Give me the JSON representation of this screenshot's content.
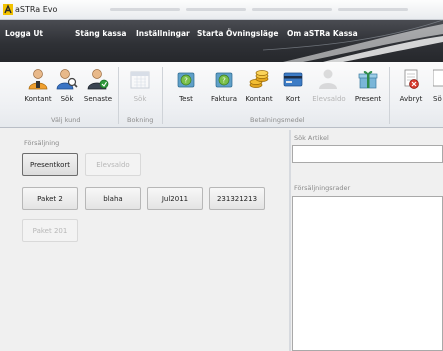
{
  "window": {
    "title": "aSTRa Evo"
  },
  "menu": {
    "items": [
      {
        "label": "Logga Ut"
      },
      {
        "label": "Stäng kassa"
      },
      {
        "label": "Inställningar"
      },
      {
        "label": "Starta Övningsläge"
      },
      {
        "label": "Om aSTRa Kassa"
      }
    ]
  },
  "ribbon": {
    "valj_kund": {
      "label": "Välj kund",
      "buttons": [
        {
          "label": "Kontant",
          "icon": "customer-icon"
        },
        {
          "label": "Sök",
          "icon": "customer-search-icon"
        },
        {
          "label": "Senaste",
          "icon": "customer-recent-icon"
        }
      ]
    },
    "bokning": {
      "label": "Bokning",
      "buttons": [
        {
          "label": "Sök",
          "icon": "calendar-icon",
          "disabled": true
        }
      ]
    },
    "betalningsmedel": {
      "label": "Betalningsmedel",
      "buttons": [
        {
          "label": "Test",
          "icon": "payment-icon"
        },
        {
          "label": "Faktura",
          "icon": "invoice-icon"
        },
        {
          "label": "Kontant",
          "icon": "coins-icon"
        },
        {
          "label": "Kort",
          "icon": "card-icon"
        },
        {
          "label": "Elevsaldo",
          "icon": "student-balance-icon",
          "disabled": true
        },
        {
          "label": "Present",
          "icon": "gift-icon"
        }
      ]
    },
    "avbryt": {
      "label": "Avbryt",
      "icon": "cancel-icon"
    },
    "cut_label": "Sö"
  },
  "forsaljning": {
    "label": "Försäljning",
    "tabs": [
      {
        "label": "Presentkort",
        "selected": true
      },
      {
        "label": "Elevsaldo",
        "disabled": true
      }
    ],
    "products": [
      {
        "label": "Paket 2"
      },
      {
        "label": "blaha"
      },
      {
        "label": "Jul2011"
      },
      {
        "label": "231321213"
      },
      {
        "label": "Paket 201",
        "disabled": true
      }
    ]
  },
  "search": {
    "label": "Sök Artikel",
    "value": ""
  },
  "rows": {
    "label": "Försäljningsrader"
  }
}
